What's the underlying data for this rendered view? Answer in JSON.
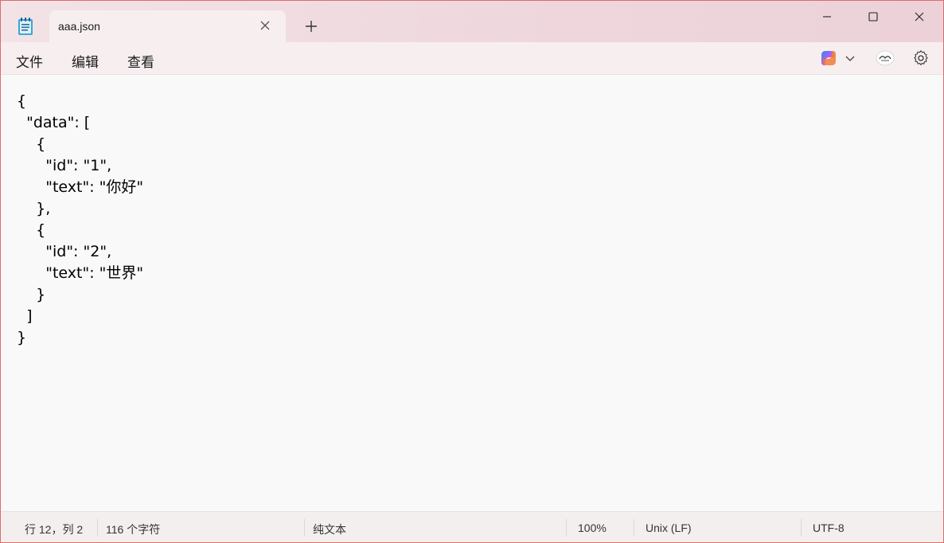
{
  "tab": {
    "title": "aaa.json"
  },
  "menu": {
    "file": "文件",
    "edit": "编辑",
    "view": "查看"
  },
  "editor": {
    "content": "{\n  \"data\": [\n    {\n      \"id\": \"1\",\n      \"text\": \"你好\"\n    },\n    {\n      \"id\": \"2\",\n      \"text\": \"世界\"\n    }\n  ]\n}"
  },
  "status": {
    "position": "行 12，列 2",
    "char_count": "116 个字符",
    "format": "纯文本",
    "zoom": "100%",
    "line_ending": "Unix (LF)",
    "encoding": "UTF-8"
  },
  "icons": {
    "app": "notepad-icon",
    "tab_close": "close-icon",
    "new_tab": "plus-icon",
    "minimize": "minimize-icon",
    "maximize": "maximize-icon",
    "close": "close-icon",
    "copilot": "copilot-icon",
    "dropdown": "chevron-down-icon",
    "account": "account-icon",
    "settings": "gear-icon"
  },
  "colors": {
    "accent": "#e06a6a",
    "titlebar": "#eed6dc",
    "editor_bg": "#f9f9f9"
  }
}
